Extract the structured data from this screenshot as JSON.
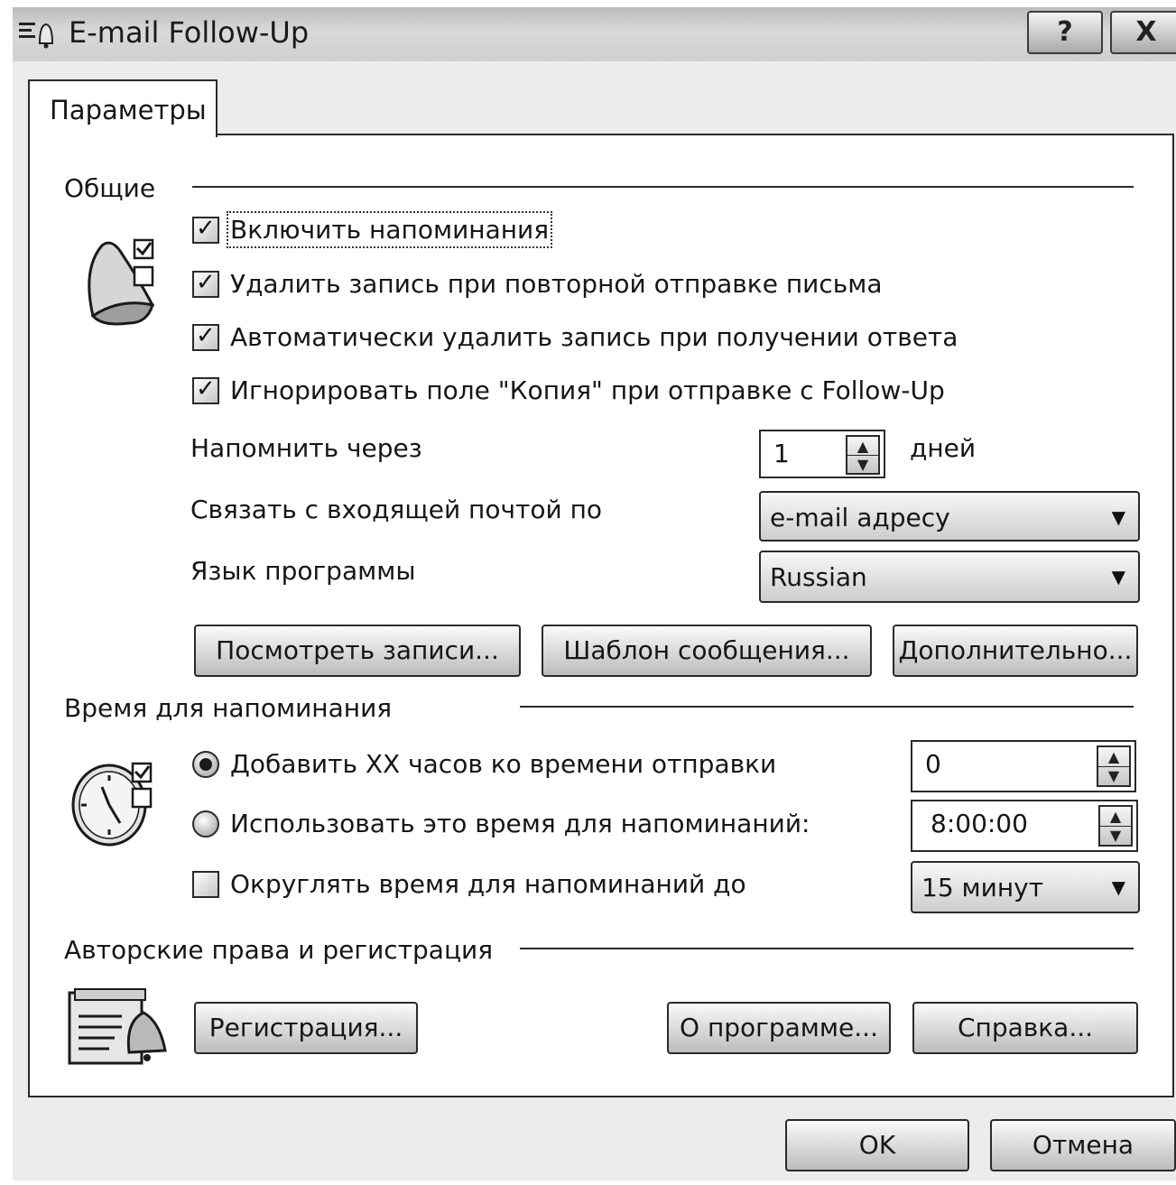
{
  "window": {
    "title": "E-mail Follow-Up",
    "help_label": "?",
    "close_label": "X"
  },
  "tabs": [
    {
      "label": "Параметры",
      "selected": true
    }
  ],
  "general": {
    "section_label": "Общие",
    "icon": "bell-checklist-icon",
    "checkboxes": [
      {
        "label": "Включить напоминания",
        "checked": true
      },
      {
        "label": "Удалить запись при повторной отправке письма",
        "checked": true
      },
      {
        "label": "Автоматически удалить запись при получении ответа",
        "checked": true
      },
      {
        "label": "Игнорировать поле \"Копия\" при отправке c Follow-Up",
        "checked": true
      }
    ],
    "remind_after": {
      "label": "Напомнить через",
      "value": "1",
      "unit": "дней"
    },
    "link_inbox": {
      "label": "Связать с входящей почтой по",
      "value": "e-mail адресу"
    },
    "language": {
      "label": "Язык программы",
      "value": "Russian"
    },
    "buttons": {
      "view_records": "Посмотреть записи...",
      "message_template": "Шаблон сообщения...",
      "advanced": "Дополнительно..."
    }
  },
  "reminder_time": {
    "section_label": "Время для напоминания",
    "icon": "clock-checklist-icon",
    "add_hours": {
      "label": "Добавить XX часов ко времени отправки",
      "selected": true,
      "value": "0"
    },
    "use_time": {
      "label": "Использовать это время для напоминаний:",
      "selected": false,
      "value": "8:00:00"
    },
    "round": {
      "label": "Округлять время для напоминаний до",
      "checked": false,
      "value": "15 минут"
    }
  },
  "copyright": {
    "section_label": "Авторские права и регистрация",
    "icon": "registration-document-icon",
    "buttons": {
      "registration": "Регистрация...",
      "about": "О программе...",
      "help": "Справка..."
    }
  },
  "footer": {
    "ok_label": "OK",
    "cancel_label": "Отмена"
  }
}
